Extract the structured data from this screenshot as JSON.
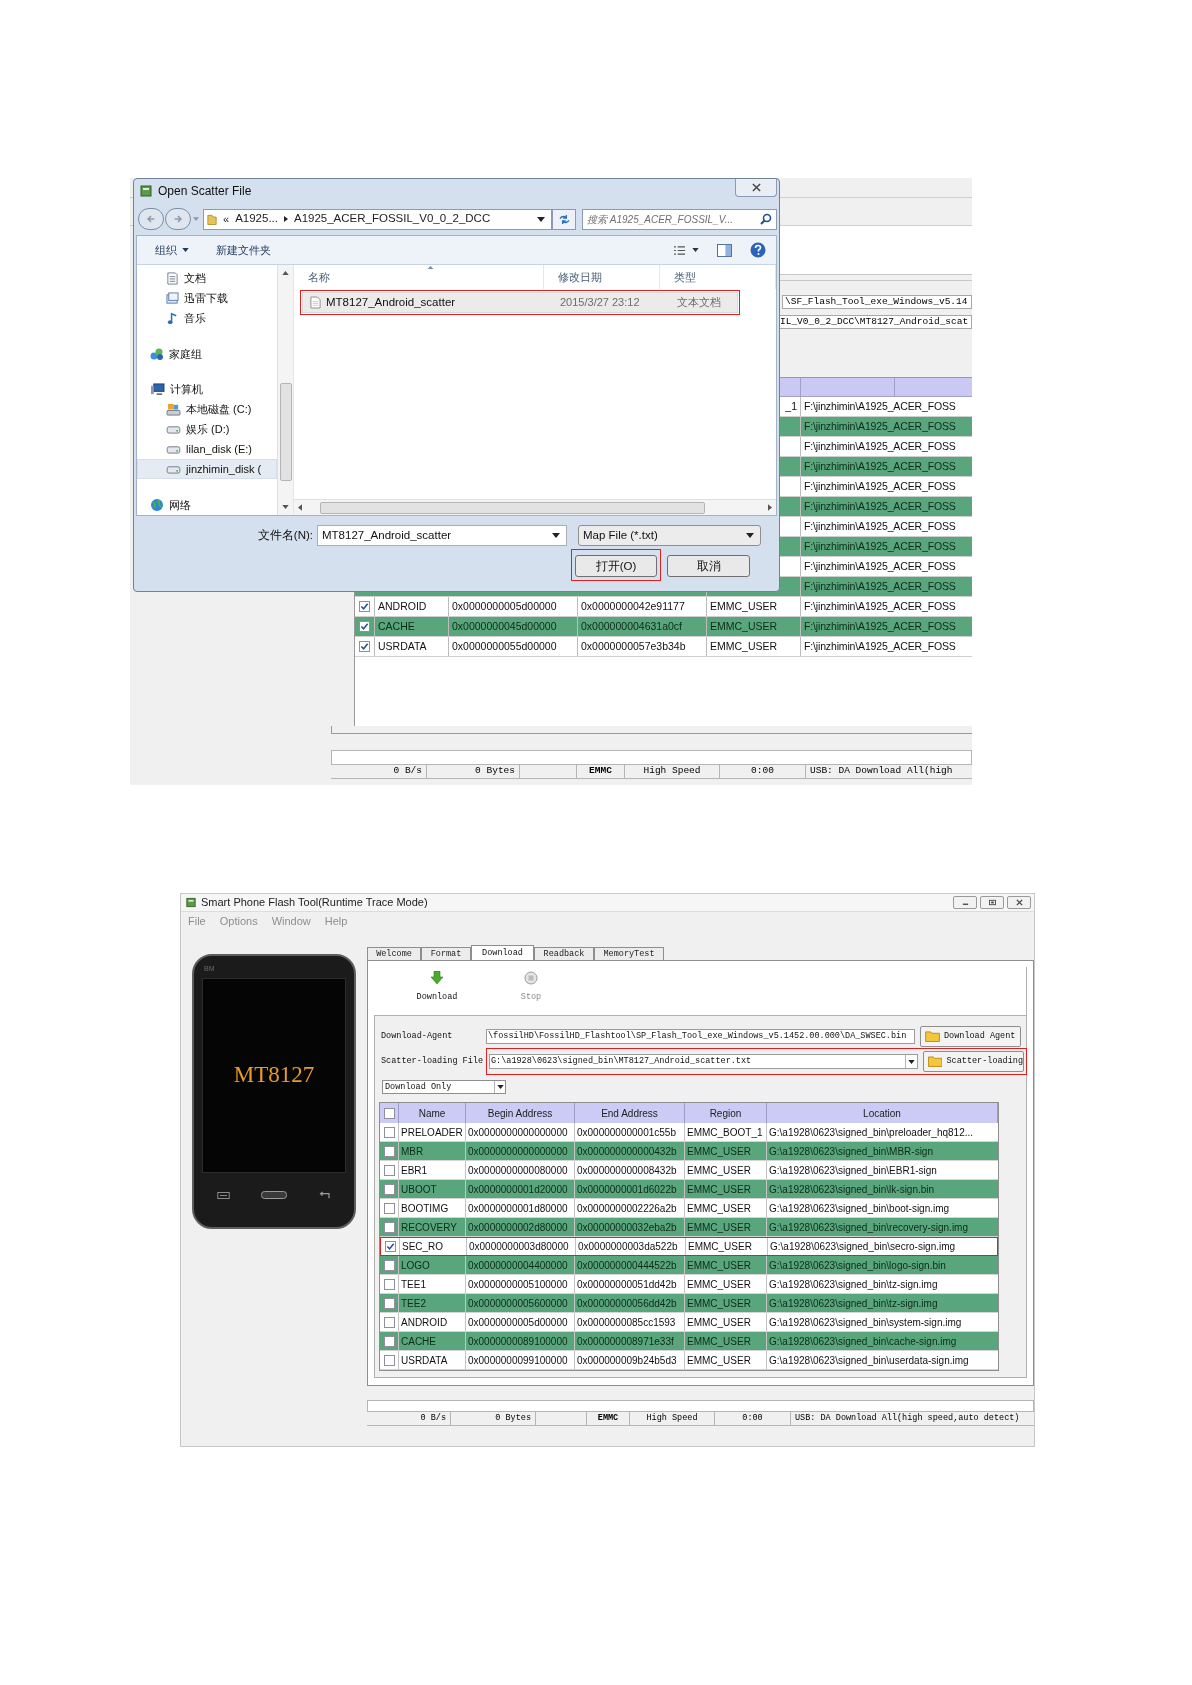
{
  "scatter_dialog_screenshot": {
    "tool_window": {
      "agent_path": "\\SF_Flash_Tool_exe_Windows_v5.14",
      "scatter_path": "IL_V0_0_2_DCC\\MT8127_Android_scat",
      "rows": [
        {
          "kind": "covered",
          "region": "_1",
          "location": "F:\\jinzhimin\\A1925_ACER_FOSS"
        },
        {
          "kind": "covered",
          "location": "F:\\jinzhimin\\A1925_ACER_FOSS"
        },
        {
          "kind": "covered",
          "location": "F:\\jinzhimin\\A1925_ACER_FOSS"
        },
        {
          "kind": "covered",
          "location": "F:\\jinzhimin\\A1925_ACER_FOSS"
        },
        {
          "kind": "covered",
          "location": "F:\\jinzhimin\\A1925_ACER_FOSS"
        },
        {
          "kind": "covered",
          "location": "F:\\jinzhimin\\A1925_ACER_FOSS"
        },
        {
          "kind": "covered",
          "location": "F:\\jinzhimin\\A1925_ACER_FOSS"
        },
        {
          "kind": "covered",
          "location": "F:\\jinzhimin\\A1925_ACER_FOSS"
        },
        {
          "kind": "covered",
          "location": "F:\\jinzhimin\\A1925_ACER_FOSS"
        },
        {
          "kind": "covered",
          "location": "F:\\jinzhimin\\A1925_ACER_FOSS"
        },
        {
          "kind": "full",
          "checked": true,
          "name": "ANDROID",
          "begin": "0x0000000005d00000",
          "end": "0x0000000042e91177",
          "region": "EMMC_USER",
          "location": "F:\\jinzhimin\\A1925_ACER_FOSS"
        },
        {
          "kind": "full",
          "checked": true,
          "name": "CACHE",
          "begin": "0x0000000045d00000",
          "end": "0x000000004631a0cf",
          "region": "EMMC_USER",
          "location": "F:\\jinzhimin\\A1925_ACER_FOSS"
        },
        {
          "kind": "full",
          "checked": true,
          "name": "USRDATA",
          "begin": "0x0000000055d00000",
          "end": "0x0000000057e3b34b",
          "region": "EMMC_USER",
          "location": "F:\\jinzhimin\\A1925_ACER_FOSS"
        }
      ],
      "status_bar": {
        "rate": "0 B/s",
        "bytes": "0 Bytes",
        "storage": "EMMC",
        "speed": "High Speed",
        "time": "0:00",
        "message": "USB: DA Download All(high"
      }
    },
    "dialog": {
      "title": "Open Scatter File",
      "breadcrumb": {
        "overflow": "«",
        "parts": [
          "A1925...",
          "A1925_ACER_FOSSIL_V0_0_2_DCC"
        ]
      },
      "search": {
        "placeholder": "搜索 A1925_ACER_FOSSIL_V..."
      },
      "toolbar": {
        "organize": "组织",
        "new_folder": "新建文件夹"
      },
      "nav": [
        {
          "kind": "documents",
          "label": "文档",
          "selected": false
        },
        {
          "kind": "downloads",
          "label": "迅雷下载",
          "selected": false
        },
        {
          "kind": "music",
          "label": "音乐",
          "selected": false
        },
        {
          "kind": "homegroup",
          "label": "家庭组",
          "selected": false
        },
        {
          "kind": "computer",
          "label": "计算机",
          "selected": false
        },
        {
          "kind": "system_drive",
          "label": "本地磁盘 (C:)",
          "selected": false
        },
        {
          "kind": "drive",
          "label": "娱乐 (D:)",
          "selected": false
        },
        {
          "kind": "drive",
          "label": "lilan_disk (E:)",
          "selected": false
        },
        {
          "kind": "drive",
          "label": "jinzhimin_disk (",
          "selected": true
        },
        {
          "kind": "network",
          "label": "网络",
          "selected": false
        }
      ],
      "columns": [
        "名称",
        "修改日期",
        "类型"
      ],
      "files": [
        {
          "name": "MT8127_Android_scatter",
          "modified": "2015/3/27 23:12",
          "type": "文本文档",
          "selected": true,
          "highlighted": true
        }
      ],
      "file_name_label": "文件名(N):",
      "file_name": "MT8127_Android_scatter",
      "file_type": "Map File (*.txt)",
      "buttons": [
        {
          "label": "打开(O)",
          "highlighted": true
        },
        {
          "label": "取消",
          "highlighted": false
        }
      ]
    }
  },
  "flash_tool_screenshot": {
    "title": "Smart Phone Flash Tool(Runtime Trace Mode)",
    "menu": [
      "File",
      "Options",
      "Window",
      "Help"
    ],
    "phone": {
      "badge": "BM",
      "model": "MT8127"
    },
    "tabs": [
      {
        "label": "Welcome",
        "selected": false
      },
      {
        "label": "Format",
        "selected": false
      },
      {
        "label": "Download",
        "selected": true
      },
      {
        "label": "Readback",
        "selected": false
      },
      {
        "label": "MemoryTest",
        "selected": false
      }
    ],
    "toolbar": [
      {
        "kind": "download",
        "label": "Download",
        "disabled": false
      },
      {
        "kind": "stop",
        "label": "Stop",
        "disabled": true
      }
    ],
    "download_agent": {
      "label": "Download-Agent",
      "value": "\\fossilHD\\FossilHD_Flashtool\\SP_Flash_Tool_exe_Windows_v5.1452.00.000\\DA_SWSEC.bin",
      "button": "Download Agent"
    },
    "scatter_file": {
      "label": "Scatter-loading File",
      "value": "G:\\a1928\\0623\\signed_bin\\MT8127_Android_scatter.txt",
      "button": "Scatter-loading",
      "highlighted": true
    },
    "mode": "Download Only",
    "table": {
      "all_checked": false,
      "columns": [
        "Name",
        "Begin Address",
        "End Address",
        "Region",
        "Location"
      ],
      "rows": [
        {
          "checked": false,
          "highlighted": false,
          "name": "PRELOADER",
          "begin": "0x0000000000000000",
          "end": "0x000000000001c55b",
          "region": "EMMC_BOOT_1",
          "location": "G:\\a1928\\0623\\signed_bin\\preloader_hq812..."
        },
        {
          "checked": false,
          "highlighted": false,
          "name": "MBR",
          "begin": "0x0000000000000000",
          "end": "0x000000000000432b",
          "region": "EMMC_USER",
          "location": "G:\\a1928\\0623\\signed_bin\\MBR-sign"
        },
        {
          "checked": false,
          "highlighted": false,
          "name": "EBR1",
          "begin": "0x0000000000080000",
          "end": "0x000000000008432b",
          "region": "EMMC_USER",
          "location": "G:\\a1928\\0623\\signed_bin\\EBR1-sign"
        },
        {
          "checked": false,
          "highlighted": false,
          "name": "UBOOT",
          "begin": "0x0000000001d20000",
          "end": "0x0000000001d6022b",
          "region": "EMMC_USER",
          "location": "G:\\a1928\\0623\\signed_bin\\lk-sign.bin"
        },
        {
          "checked": false,
          "highlighted": false,
          "name": "BOOTIMG",
          "begin": "0x0000000001d80000",
          "end": "0x0000000002226a2b",
          "region": "EMMC_USER",
          "location": "G:\\a1928\\0623\\signed_bin\\boot-sign.img"
        },
        {
          "checked": false,
          "highlighted": false,
          "name": "RECOVERY",
          "begin": "0x0000000002d80000",
          "end": "0x00000000032eba2b",
          "region": "EMMC_USER",
          "location": "G:\\a1928\\0623\\signed_bin\\recovery-sign.img"
        },
        {
          "checked": true,
          "highlighted": true,
          "name": "SEC_RO",
          "begin": "0x0000000003d80000",
          "end": "0x0000000003da522b",
          "region": "EMMC_USER",
          "location": "G:\\a1928\\0623\\signed_bin\\secro-sign.img"
        },
        {
          "checked": false,
          "highlighted": false,
          "name": "LOGO",
          "begin": "0x0000000004400000",
          "end": "0x000000000444522b",
          "region": "EMMC_USER",
          "location": "G:\\a1928\\0623\\signed_bin\\logo-sign.bin"
        },
        {
          "checked": false,
          "highlighted": false,
          "name": "TEE1",
          "begin": "0x0000000005100000",
          "end": "0x00000000051dd42b",
          "region": "EMMC_USER",
          "location": "G:\\a1928\\0623\\signed_bin\\tz-sign.img"
        },
        {
          "checked": false,
          "highlighted": false,
          "name": "TEE2",
          "begin": "0x0000000005600000",
          "end": "0x00000000056dd42b",
          "region": "EMMC_USER",
          "location": "G:\\a1928\\0623\\signed_bin\\tz-sign.img"
        },
        {
          "checked": false,
          "highlighted": false,
          "name": "ANDROID",
          "begin": "0x0000000005d00000",
          "end": "0x0000000085cc1593",
          "region": "EMMC_USER",
          "location": "G:\\a1928\\0623\\signed_bin\\system-sign.img"
        },
        {
          "checked": false,
          "highlighted": false,
          "name": "CACHE",
          "begin": "0x0000000089100000",
          "end": "0x000000008971e33f",
          "region": "EMMC_USER",
          "location": "G:\\a1928\\0623\\signed_bin\\cache-sign.img"
        },
        {
          "checked": false,
          "highlighted": false,
          "name": "USRDATA",
          "begin": "0x0000000099100000",
          "end": "0x000000009b24b5d3",
          "region": "EMMC_USER",
          "location": "G:\\a1928\\0623\\signed_bin\\userdata-sign.img"
        }
      ]
    },
    "status_bar": {
      "rate": "0 B/s",
      "bytes": "0 Bytes",
      "storage": "EMMC",
      "speed": "High Speed",
      "time": "0:00",
      "message": "USB: DA Download All(high speed,auto detect)"
    }
  }
}
